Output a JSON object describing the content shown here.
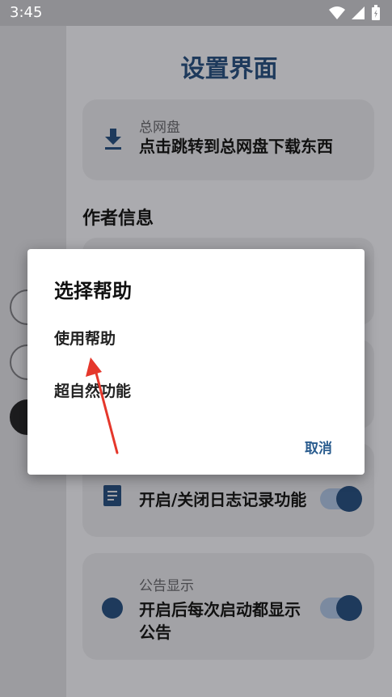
{
  "status_bar": {
    "time": "3:45"
  },
  "page": {
    "title": "设置界面"
  },
  "cards": {
    "download": {
      "caption": "总网盘",
      "text": "点击跳转到总网盘下载东西"
    },
    "section_author": "作者信息",
    "log": {
      "text": "开启/关闭日志记录功能"
    },
    "notice": {
      "caption": "公告显示",
      "text": "开启后每次启动都显示公告"
    }
  },
  "dialog": {
    "title": "选择帮助",
    "options": [
      "使用帮助",
      "超自然功能"
    ],
    "cancel_label": "取消"
  },
  "colors": {
    "accent": "#1e3a5c",
    "dialog_button": "#2b5d8f"
  }
}
